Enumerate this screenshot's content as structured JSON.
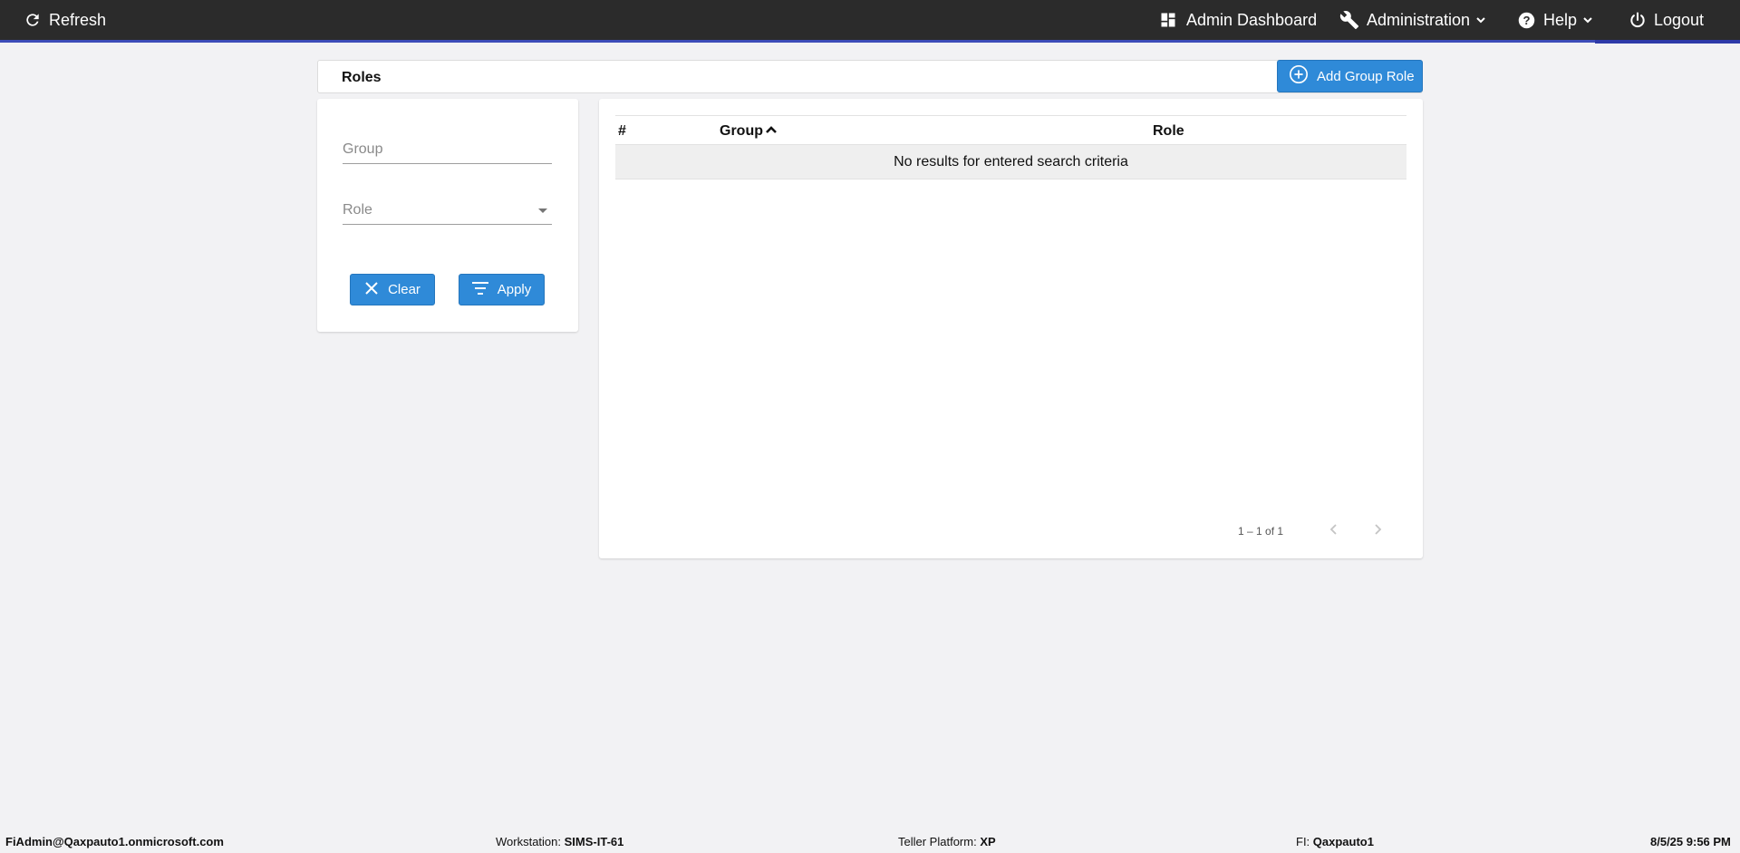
{
  "topbar": {
    "refresh_label": "Refresh",
    "admin_dashboard_label": "Admin Dashboard",
    "administration_label": "Administration",
    "help_label": "Help",
    "logout_label": "Logout"
  },
  "header": {
    "title": "Roles",
    "add_button_label": "Add Group Role"
  },
  "filters": {
    "group_placeholder": "Group",
    "group_value": "",
    "role_placeholder": "Role",
    "role_value": "",
    "clear_label": "Clear",
    "apply_label": "Apply"
  },
  "table": {
    "columns": [
      "#",
      "Group",
      "Role"
    ],
    "sort_column": "Group",
    "sort_direction": "ascending",
    "empty_message": "No results for entered search criteria",
    "pagination_text": "1 – 1 of 1"
  },
  "statusbar": {
    "user": "FiAdmin@Qaxpauto1.onmicrosoft.com",
    "workstation_label": "Workstation:",
    "workstation_value": "SIMS-IT-61",
    "platform_label": "Teller Platform:",
    "platform_value": "XP",
    "fi_label": "FI:",
    "fi_value": "Qaxpauto1",
    "datetime": "8/5/25 9:56 PM"
  },
  "colors": {
    "topbar_bg": "#2b2b2b",
    "accent_blue": "#2f8ad8",
    "page_bg": "#f2f2f4",
    "empty_row_bg": "#efefef"
  },
  "icons": {
    "refresh": "refresh-icon",
    "dashboard": "dashboard-icon",
    "administration": "wrench-icon",
    "help": "help-circle-icon",
    "logout": "power-icon",
    "add": "plus-circle-icon",
    "clear": "close-icon",
    "apply": "filter-icon",
    "sort": "chevron-up-icon",
    "prev": "chevron-left-icon",
    "next": "chevron-right-icon"
  }
}
